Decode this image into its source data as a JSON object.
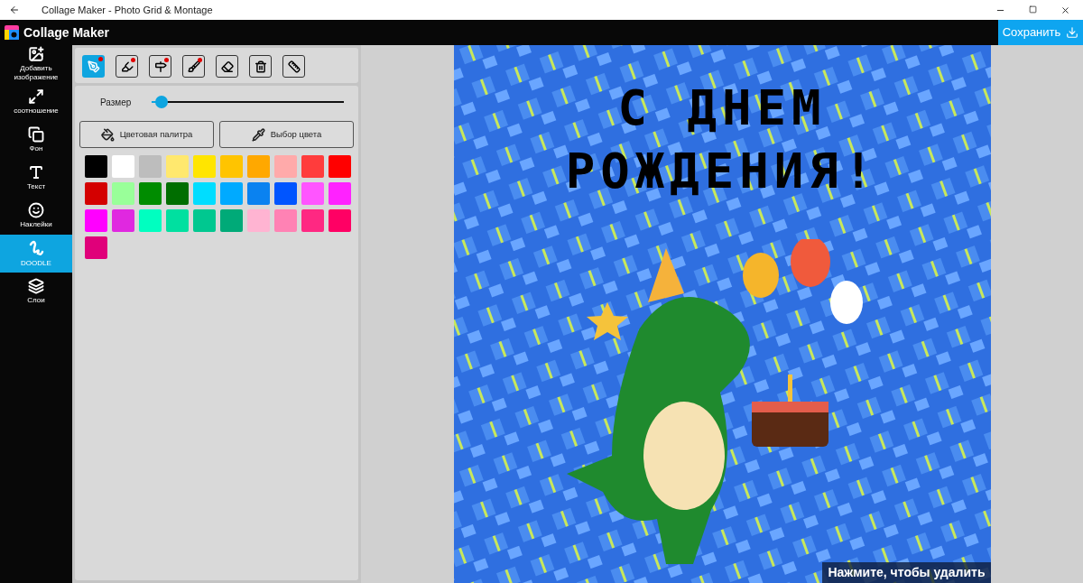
{
  "window": {
    "title": "Collage Maker - Photo Grid & Montage"
  },
  "app": {
    "name": "Collage Maker",
    "save_label": "Сохранить"
  },
  "sidebar": [
    {
      "label": "Добавить изображение",
      "selected": false
    },
    {
      "label": "соотношение",
      "selected": false
    },
    {
      "label": "Фон",
      "selected": false
    },
    {
      "label": "Текст",
      "selected": false
    },
    {
      "label": "Наклейки",
      "selected": false
    },
    {
      "label": "DOODLE",
      "selected": true
    },
    {
      "label": "Слои",
      "selected": false
    }
  ],
  "tools": [
    {
      "selected": true,
      "dot": true
    },
    {
      "selected": false,
      "dot": true
    },
    {
      "selected": false,
      "dot": true
    },
    {
      "selected": false,
      "dot": true
    },
    {
      "selected": false,
      "dot": false
    },
    {
      "selected": false,
      "dot": false
    },
    {
      "selected": false,
      "dot": false
    }
  ],
  "size": {
    "label": "Размер",
    "level": 0.05
  },
  "buttons": [
    {
      "label": "Цветовая палитра"
    },
    {
      "label": "Выбор цвета"
    }
  ],
  "palette": [
    {
      "color": "#000000"
    },
    {
      "color": "#ffffff"
    },
    {
      "color": "#bdbdbd"
    },
    {
      "color": "#ffe86e"
    },
    {
      "color": "#ffe500"
    },
    {
      "color": "#ffc400"
    },
    {
      "color": "#ffa800"
    },
    {
      "color": "#ffaaaa"
    },
    {
      "color": "#ff3c3c"
    },
    {
      "color": "#ff0000"
    },
    {
      "color": "#d40000"
    },
    {
      "color": "#99ff99"
    },
    {
      "color": "#008c00"
    },
    {
      "color": "#006e00"
    },
    {
      "color": "#00ddff"
    },
    {
      "color": "#00aaff"
    },
    {
      "color": "#0a82f0"
    },
    {
      "color": "#0055ff"
    },
    {
      "color": "#ff55ff"
    },
    {
      "color": "#ff22ff"
    },
    {
      "color": "#ff00ff"
    },
    {
      "color": "#e028e0"
    },
    {
      "color": "#00ffc0"
    },
    {
      "color": "#00e0a0"
    },
    {
      "color": "#00c890"
    },
    {
      "color": "#00aa78"
    },
    {
      "color": "#ffb4d2"
    },
    {
      "color": "#ff82b4"
    },
    {
      "color": "#ff2882"
    },
    {
      "color": "#ff0064"
    },
    {
      "color": "#e0007a"
    }
  ],
  "canvas": {
    "text_lines": [
      "С ДНЕМ",
      "РОЖДЕНИЯ!"
    ],
    "hint": "Нажмите, чтобы удалить"
  }
}
